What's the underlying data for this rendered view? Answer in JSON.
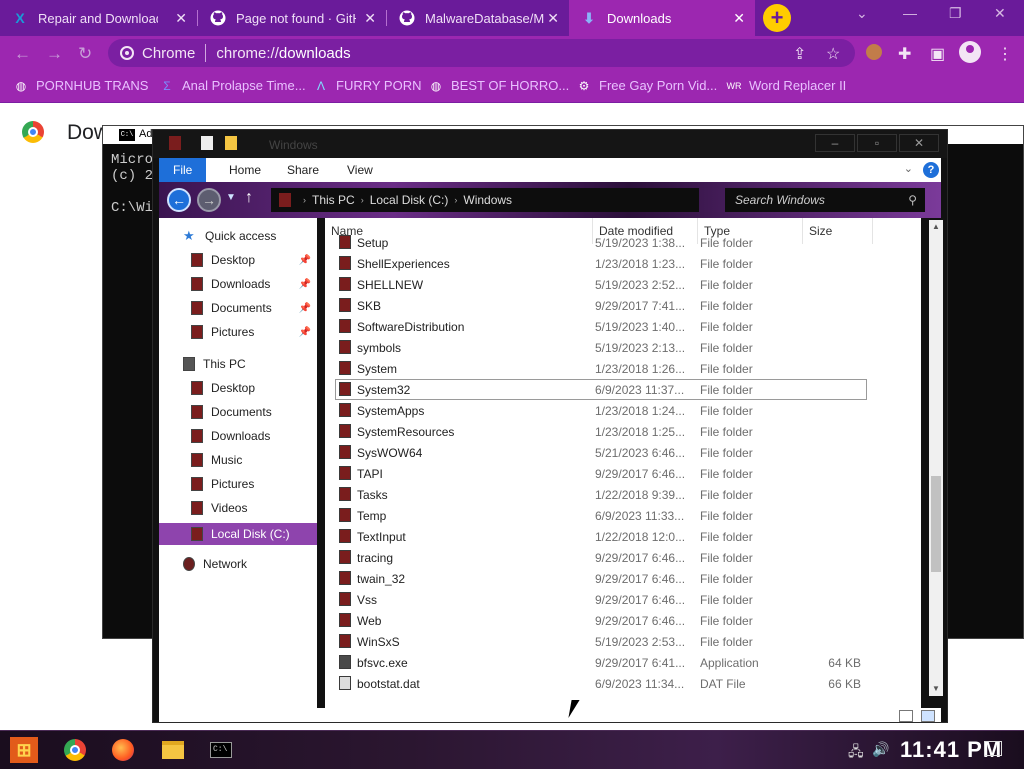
{
  "browser": {
    "tabs": [
      {
        "title": "Repair and Download",
        "icon": "x-logo-icon",
        "icon_color": "#1a9bd7"
      },
      {
        "title": "Page not found · GitHub",
        "icon": "github-icon",
        "icon_color": "#ffffff"
      },
      {
        "title": "MalwareDatabase/MEMZ",
        "icon": "github-icon",
        "icon_color": "#ffffff"
      },
      {
        "title": "Downloads",
        "icon": "download-icon",
        "icon_color": "#8ab4f8",
        "active": true
      }
    ],
    "new_tab_symbol": "+",
    "omnibox": {
      "site": "Chrome",
      "url_scheme": "chrome://",
      "url_host": "downloads"
    },
    "bookmarks": [
      {
        "label": "PORNHUB TRANS",
        "icon": "globe-icon"
      },
      {
        "label": "Anal Prolapse Time...",
        "icon": "bookmark-logo-icon"
      },
      {
        "label": "FURRY PORN",
        "icon": "lambda-icon"
      },
      {
        "label": "BEST OF HORRO...",
        "icon": "globe-icon"
      },
      {
        "label": "Free Gay Porn Vid...",
        "icon": "gear-icon"
      },
      {
        "label": "Word Replacer II",
        "icon": "wr-icon"
      }
    ],
    "page_title": "Dow",
    "accent": "#9c27b0",
    "tabstrip_color": "#6a1b9a"
  },
  "cmd": {
    "title": "Ad",
    "lines": [
      "Micro",
      "(c) 2",
      "",
      "C:\\Wi"
    ]
  },
  "explorer": {
    "title": "Windows",
    "ribbon_tabs": [
      "File",
      "Home",
      "Share",
      "View"
    ],
    "breadcrumb": [
      "This PC",
      "Local Disk (C:)",
      "Windows"
    ],
    "search_placeholder": "Search Windows",
    "nav": {
      "quick_access": "Quick access",
      "quick_items": [
        "Desktop",
        "Downloads",
        "Documents",
        "Pictures"
      ],
      "this_pc": "This PC",
      "pc_items": [
        "Desktop",
        "Documents",
        "Downloads",
        "Music",
        "Pictures",
        "Videos",
        "Local Disk (C:)"
      ],
      "network": "Network"
    },
    "columns": [
      "Name",
      "Date modified",
      "Type",
      "Size"
    ],
    "files": [
      {
        "name": "Setup",
        "date": "5/19/2023 1:38...",
        "type": "File folder",
        "size": ""
      },
      {
        "name": "ShellExperiences",
        "date": "1/23/2018 1:23...",
        "type": "File folder",
        "size": ""
      },
      {
        "name": "SHELLNEW",
        "date": "5/19/2023 2:52...",
        "type": "File folder",
        "size": ""
      },
      {
        "name": "SKB",
        "date": "9/29/2017 7:41...",
        "type": "File folder",
        "size": ""
      },
      {
        "name": "SoftwareDistribution",
        "date": "5/19/2023 1:40...",
        "type": "File folder",
        "size": ""
      },
      {
        "name": "symbols",
        "date": "5/19/2023 2:13...",
        "type": "File folder",
        "size": ""
      },
      {
        "name": "System",
        "date": "1/23/2018 1:26...",
        "type": "File folder",
        "size": ""
      },
      {
        "name": "System32",
        "date": "6/9/2023 11:37...",
        "type": "File folder",
        "size": "",
        "selected": true
      },
      {
        "name": "SystemApps",
        "date": "1/23/2018 1:24...",
        "type": "File folder",
        "size": ""
      },
      {
        "name": "SystemResources",
        "date": "1/23/2018 1:25...",
        "type": "File folder",
        "size": ""
      },
      {
        "name": "SysWOW64",
        "date": "5/21/2023 6:46...",
        "type": "File folder",
        "size": ""
      },
      {
        "name": "TAPI",
        "date": "9/29/2017 6:46...",
        "type": "File folder",
        "size": ""
      },
      {
        "name": "Tasks",
        "date": "1/22/2018 9:39...",
        "type": "File folder",
        "size": ""
      },
      {
        "name": "Temp",
        "date": "6/9/2023 11:33...",
        "type": "File folder",
        "size": ""
      },
      {
        "name": "TextInput",
        "date": "1/22/2018 12:0...",
        "type": "File folder",
        "size": ""
      },
      {
        "name": "tracing",
        "date": "9/29/2017 6:46...",
        "type": "File folder",
        "size": ""
      },
      {
        "name": "twain_32",
        "date": "9/29/2017 6:46...",
        "type": "File folder",
        "size": ""
      },
      {
        "name": "Vss",
        "date": "9/29/2017 6:46...",
        "type": "File folder",
        "size": ""
      },
      {
        "name": "Web",
        "date": "9/29/2017 6:46...",
        "type": "File folder",
        "size": ""
      },
      {
        "name": "WinSxS",
        "date": "5/19/2023 2:53...",
        "type": "File folder",
        "size": ""
      },
      {
        "name": "bfsvc.exe",
        "date": "9/29/2017 6:41...",
        "type": "Application",
        "size": "64 KB"
      },
      {
        "name": "bootstat.dat",
        "date": "6/9/2023 11:34...",
        "type": "DAT File",
        "size": "66 KB"
      }
    ]
  },
  "taskbar": {
    "apps": [
      "start-icon",
      "chrome-icon",
      "firefox-icon",
      "file-explorer-icon",
      "cmd-icon"
    ],
    "clock": "11:41 PM"
  }
}
